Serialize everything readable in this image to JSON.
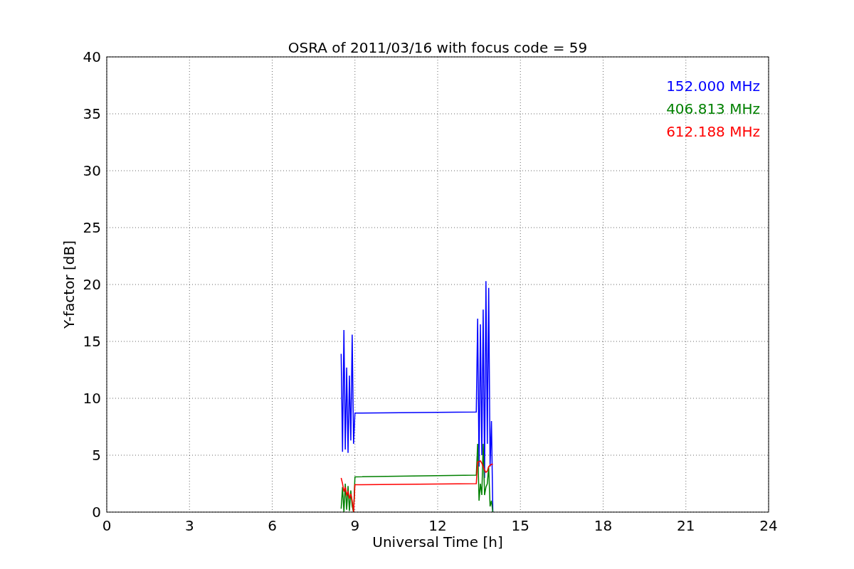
{
  "figure": {
    "chart_data": {
      "type": "line",
      "title": "OSRA of 2011/03/16 with focus code = 59",
      "xlabel": "Universal Time [h]",
      "ylabel": "Y-factor [dB]",
      "x": [
        8.5,
        8.55,
        8.6,
        8.65,
        8.7,
        8.75,
        8.8,
        8.85,
        8.9,
        8.95,
        9.0,
        13.4,
        13.45,
        13.5,
        13.55,
        13.6,
        13.65,
        13.7,
        13.75,
        13.8,
        13.85,
        13.9,
        13.95,
        14.0
      ],
      "series": [
        {
          "name": "152.000 MHz",
          "color": "#0000ff",
          "values": [
            13.9,
            5.3,
            16,
            5.5,
            12.7,
            5.2,
            12,
            6.3,
            15.6,
            6,
            8.7,
            8.8,
            17,
            4,
            16.5,
            5,
            17.8,
            3,
            20.3,
            6,
            19.7,
            4,
            8,
            0
          ]
        },
        {
          "name": "406.813 MHz",
          "color": "#008000",
          "values": [
            0.3,
            2.2,
            0,
            2.5,
            0.2,
            2.3,
            0.1,
            1.9,
            0.5,
            0,
            3.1,
            3.25,
            6,
            1,
            2.5,
            1.5,
            6,
            1.5,
            2.2,
            2.5,
            4,
            0.5,
            1,
            0
          ]
        },
        {
          "name": "612.188 MHz",
          "color": "#ff0000",
          "values": [
            3,
            2.5,
            1.8,
            2.2,
            1.5,
            1.8,
            1.2,
            1.6,
            1.0,
            0,
            2.4,
            2.5,
            4.4,
            4.4,
            4.5,
            4.3,
            4.0,
            3.7,
            3.5,
            3.6,
            4.0,
            4.1,
            4.2,
            4.2
          ]
        }
      ],
      "grid": true,
      "xlim": [
        0,
        24
      ],
      "ylim": [
        0,
        40
      ],
      "xticks": [
        0,
        3,
        6,
        9,
        12,
        15,
        18,
        21,
        24
      ],
      "yticks": [
        0,
        5,
        10,
        15,
        20,
        25,
        30,
        35,
        40
      ]
    }
  }
}
